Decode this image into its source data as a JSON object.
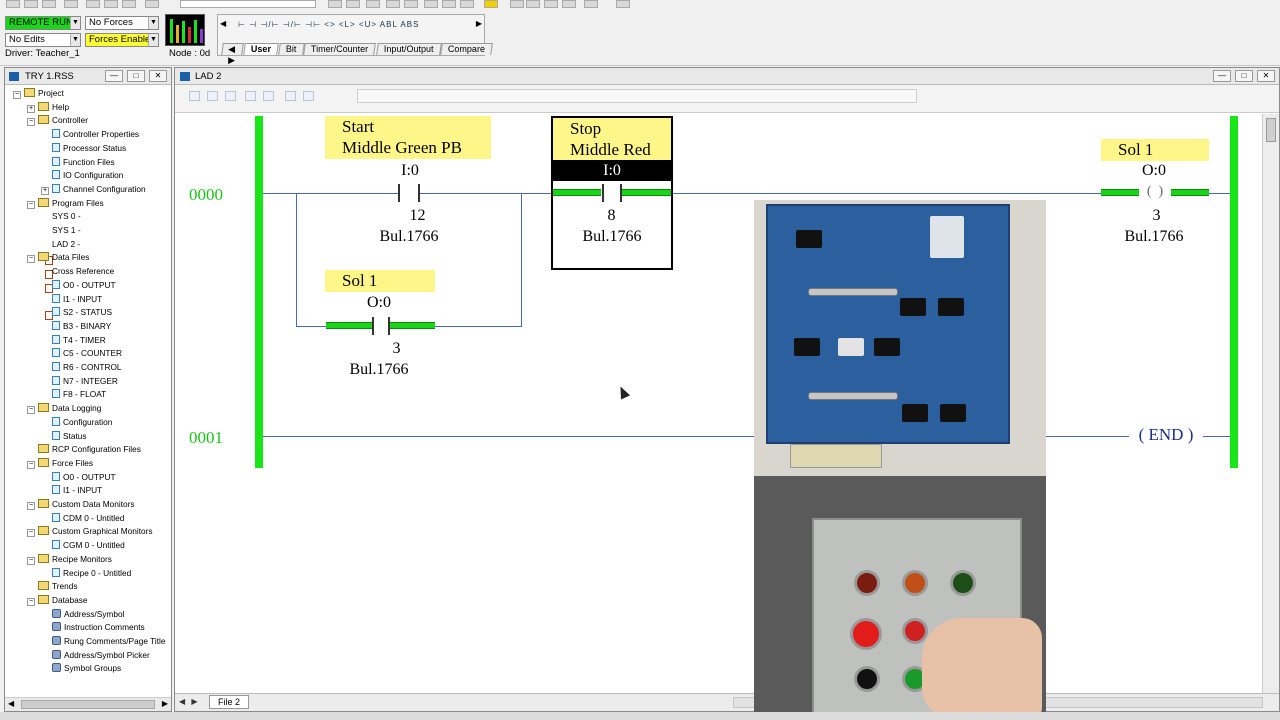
{
  "toolbar": {
    "mode": "REMOTE RUN",
    "forces": "No Forces",
    "edits": "No Edits",
    "forces_enabled": "Forces Enabled",
    "driver": "Driver: Teacher_1",
    "node": "Node : 0d",
    "instr_row": "⊢ ⊣ ⊣/⊢ ⊣/⊢ ⊣⊢ <> <L> <U> ABL ABS",
    "tabs": [
      "User",
      "Bit",
      "Timer/Counter",
      "Input/Output",
      "Compare"
    ]
  },
  "project_window": {
    "title": "TRY 1.RSS",
    "items": [
      {
        "label": "Project",
        "indent": 0,
        "type": "folder",
        "pm": "−"
      },
      {
        "label": "Help",
        "indent": 1,
        "type": "folder",
        "pm": "+"
      },
      {
        "label": "Controller",
        "indent": 1,
        "type": "folder",
        "pm": "−"
      },
      {
        "label": "Controller Properties",
        "indent": 2,
        "type": "file",
        "pm": ""
      },
      {
        "label": "Processor Status",
        "indent": 2,
        "type": "file",
        "pm": ""
      },
      {
        "label": "Function Files",
        "indent": 2,
        "type": "file",
        "pm": ""
      },
      {
        "label": "IO Configuration",
        "indent": 2,
        "type": "file",
        "pm": ""
      },
      {
        "label": "Channel Configuration",
        "indent": 2,
        "type": "file",
        "pm": "+"
      },
      {
        "label": "Program Files",
        "indent": 1,
        "type": "folder",
        "pm": "−"
      },
      {
        "label": "SYS 0 -",
        "indent": 2,
        "type": "ladder",
        "pm": ""
      },
      {
        "label": "SYS 1 -",
        "indent": 2,
        "type": "ladder",
        "pm": ""
      },
      {
        "label": "LAD 2 -",
        "indent": 2,
        "type": "ladder",
        "pm": ""
      },
      {
        "label": "Data Files",
        "indent": 1,
        "type": "folder",
        "pm": "−"
      },
      {
        "label": "Cross Reference",
        "indent": 2,
        "type": "ladder",
        "pm": ""
      },
      {
        "label": "O0 - OUTPUT",
        "indent": 2,
        "type": "file",
        "pm": ""
      },
      {
        "label": "I1 - INPUT",
        "indent": 2,
        "type": "file",
        "pm": ""
      },
      {
        "label": "S2 - STATUS",
        "indent": 2,
        "type": "file",
        "pm": ""
      },
      {
        "label": "B3 - BINARY",
        "indent": 2,
        "type": "file",
        "pm": ""
      },
      {
        "label": "T4 - TIMER",
        "indent": 2,
        "type": "file",
        "pm": ""
      },
      {
        "label": "C5 - COUNTER",
        "indent": 2,
        "type": "file",
        "pm": ""
      },
      {
        "label": "R6 - CONTROL",
        "indent": 2,
        "type": "file",
        "pm": ""
      },
      {
        "label": "N7 - INTEGER",
        "indent": 2,
        "type": "file",
        "pm": ""
      },
      {
        "label": "F8 - FLOAT",
        "indent": 2,
        "type": "file",
        "pm": ""
      },
      {
        "label": "Data Logging",
        "indent": 1,
        "type": "folder",
        "pm": "−"
      },
      {
        "label": "Configuration",
        "indent": 2,
        "type": "file",
        "pm": ""
      },
      {
        "label": "Status",
        "indent": 2,
        "type": "file",
        "pm": ""
      },
      {
        "label": "RCP Configuration Files",
        "indent": 1,
        "type": "folder",
        "pm": ""
      },
      {
        "label": "Force Files",
        "indent": 1,
        "type": "folder",
        "pm": "−"
      },
      {
        "label": "O0 - OUTPUT",
        "indent": 2,
        "type": "file",
        "pm": ""
      },
      {
        "label": "I1 - INPUT",
        "indent": 2,
        "type": "file",
        "pm": ""
      },
      {
        "label": "Custom Data Monitors",
        "indent": 1,
        "type": "folder",
        "pm": "−"
      },
      {
        "label": "CDM 0 - Untitled",
        "indent": 2,
        "type": "file",
        "pm": ""
      },
      {
        "label": "Custom Graphical Monitors",
        "indent": 1,
        "type": "folder",
        "pm": "−"
      },
      {
        "label": "CGM 0 - Untitled",
        "indent": 2,
        "type": "file",
        "pm": ""
      },
      {
        "label": "Recipe Monitors",
        "indent": 1,
        "type": "folder",
        "pm": "−"
      },
      {
        "label": "Recipe 0 - Untitled",
        "indent": 2,
        "type": "file",
        "pm": ""
      },
      {
        "label": "Trends",
        "indent": 1,
        "type": "folder",
        "pm": ""
      },
      {
        "label": "Database",
        "indent": 1,
        "type": "folder",
        "pm": "−"
      },
      {
        "label": "Address/Symbol",
        "indent": 2,
        "type": "db",
        "pm": ""
      },
      {
        "label": "Instruction Comments",
        "indent": 2,
        "type": "db",
        "pm": ""
      },
      {
        "label": "Rung Comments/Page Title",
        "indent": 2,
        "type": "db",
        "pm": ""
      },
      {
        "label": "Address/Symbol Picker",
        "indent": 2,
        "type": "db",
        "pm": ""
      },
      {
        "label": "Symbol Groups",
        "indent": 2,
        "type": "db",
        "pm": ""
      }
    ]
  },
  "ladder_window": {
    "title": "LAD 2",
    "file_tab": "File 2",
    "rungs": [
      "0000",
      "0001"
    ],
    "start_contact": {
      "label1": "Start",
      "label2": "Middle Green PB",
      "address": "I:0",
      "bit": "12",
      "module": "Bul.1766"
    },
    "stop_contact": {
      "label1": "Stop",
      "label2": "Middle Red",
      "address": "I:0",
      "bit": "8",
      "module": "Bul.1766"
    },
    "seal_contact": {
      "label": "Sol 1",
      "address": "O:0",
      "bit": "3",
      "module": "Bul.1766"
    },
    "output_coil": {
      "label": "Sol 1",
      "address": "O:0",
      "bit": "3",
      "module": "Bul.1766"
    },
    "end_label": "END"
  },
  "colors": {
    "rail": "#19e619",
    "label_bg": "#fff68a",
    "wire": "#4a6ab8",
    "remote_run": "#19d619",
    "forces_enabled": "#ffff33"
  }
}
